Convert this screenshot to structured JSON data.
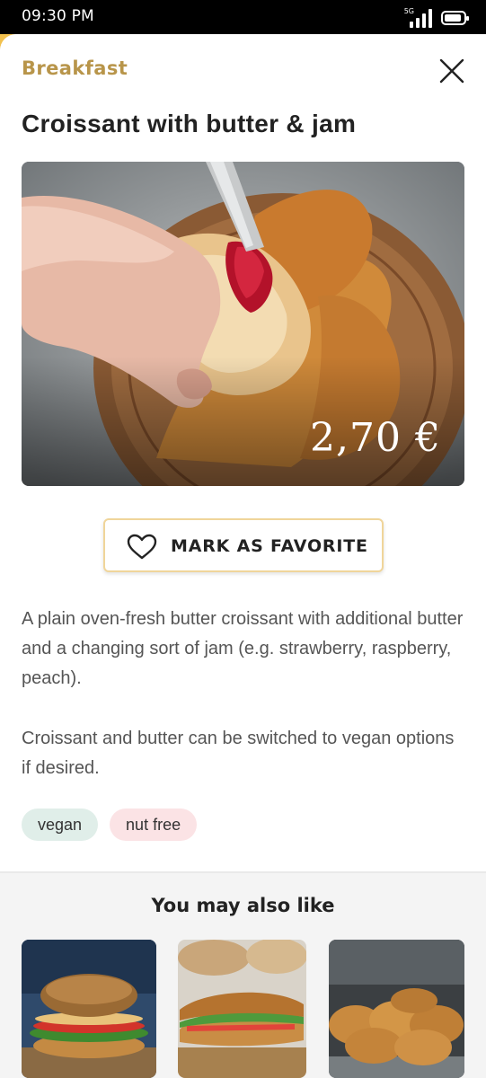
{
  "status_bar": {
    "time": "09:30 PM",
    "network": "5G",
    "icons": [
      "signal-icon",
      "battery-icon"
    ]
  },
  "header": {
    "category": "Breakfast",
    "close_icon": "close-icon"
  },
  "product": {
    "title": "Croissant with butter & jam",
    "price": "2,70 €",
    "favorite_label": "MARK AS FAVORITE",
    "favorite_icon": "heart-icon",
    "description_1": "A plain oven-fresh butter croissant with additional butter and a changing sort of jam (e.g. strawberry, raspberry, peach).",
    "description_2": "Croissant and butter can be switched to vegan options if desired.",
    "tags": [
      "vegan",
      "nut free"
    ]
  },
  "recommendations": {
    "title": "You may also like"
  },
  "colors": {
    "accent": "#b8954a",
    "button_border": "#f0d59a",
    "tag_vegan": "#e0eee9",
    "tag_nut_free": "#fbe3e5"
  }
}
